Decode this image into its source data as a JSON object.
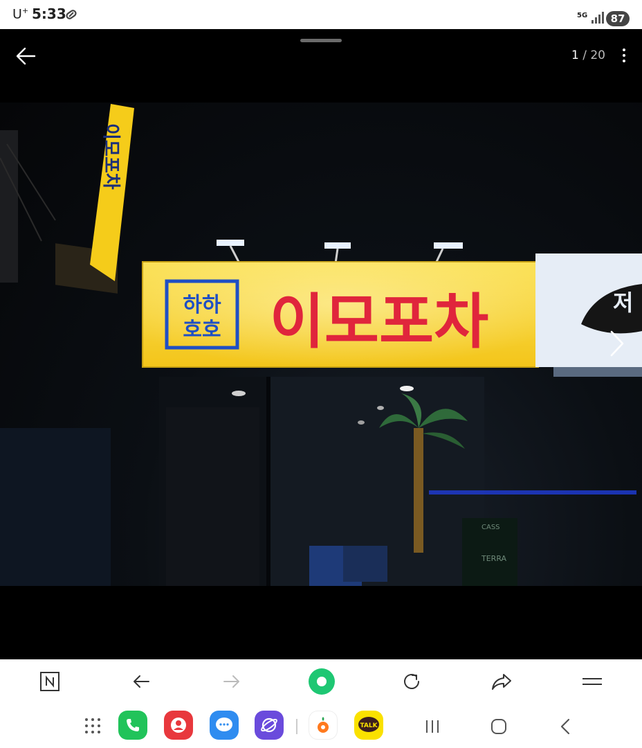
{
  "status_bar": {
    "carrier": "U",
    "carrier_sup": "+",
    "time": "5:33",
    "network": "5G",
    "battery": "87"
  },
  "viewer": {
    "counter_current": "1",
    "counter_total": " / 20",
    "photo": {
      "sign_box_line1": "하하",
      "sign_box_line2": "호호",
      "sign_main_text": "이모포차",
      "side_sign_text": "이모포차",
      "right_sign_text": "저"
    }
  },
  "browser_toolbar": {
    "buttons": [
      "naver-home",
      "back",
      "forward",
      "green-dot",
      "refresh",
      "share",
      "menu"
    ]
  },
  "dock": {
    "talk_label": "TALK"
  },
  "colors": {
    "sign_yellow": "#f7d21f",
    "sign_red": "#e0253c",
    "sign_blue": "#1f4fc4",
    "green_accent": "#1ec773"
  }
}
